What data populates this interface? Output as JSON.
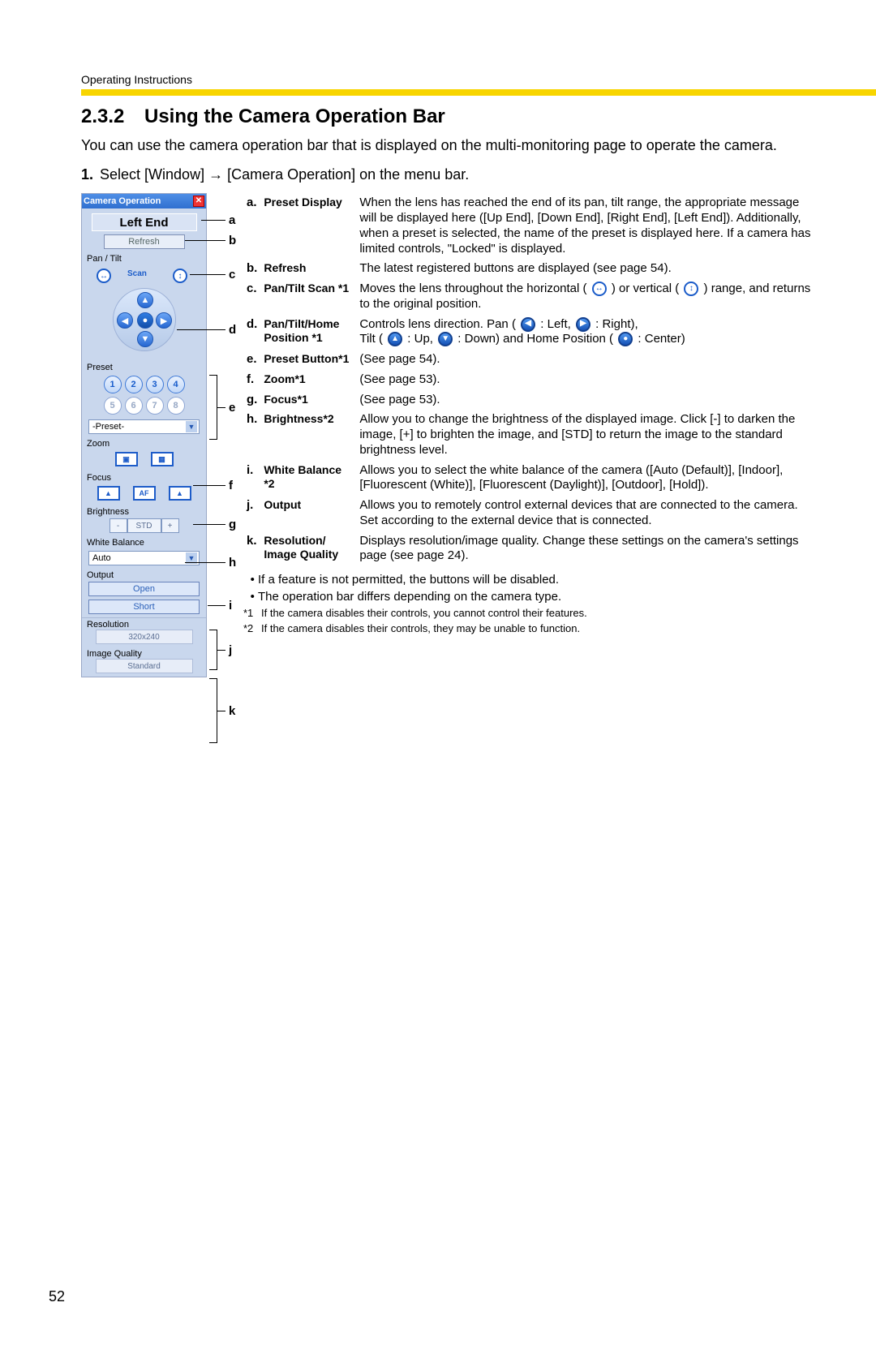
{
  "running_head": "Operating Instructions",
  "section": {
    "number": "2.3.2",
    "title": "Using the Camera Operation Bar"
  },
  "intro": "You can use the camera operation bar that is displayed on the multi-monitoring page to operate the camera.",
  "step1": {
    "num": "1.",
    "text_a": "Select [Window] ",
    "arrow": "→",
    "text_b": " [Camera Operation] on the menu bar."
  },
  "panel": {
    "title": "Camera Operation",
    "preset_display": "Left End",
    "refresh": "Refresh",
    "labels": {
      "pan_tilt": "Pan / Tilt",
      "scan": "Scan",
      "preset": "Preset",
      "zoom": "Zoom",
      "focus": "Focus",
      "brightness": "Brightness",
      "white_balance": "White Balance",
      "output": "Output",
      "resolution": "Resolution",
      "image_quality": "Image Quality"
    },
    "preset_dropdown": "-Preset-",
    "presets_active": [
      "1",
      "2",
      "3",
      "4"
    ],
    "presets_dim": [
      "5",
      "6",
      "7",
      "8"
    ],
    "brightness_buttons": {
      "minus": "-",
      "std": "STD",
      "plus": "+"
    },
    "white_balance_value": "Auto",
    "output_buttons": {
      "open": "Open",
      "short": "Short"
    },
    "resolution_value": "320x240",
    "image_quality_value": "Standard"
  },
  "callouts": {
    "a": "a",
    "b": "b",
    "c": "c",
    "d": "d",
    "e": "e",
    "f": "f",
    "g": "g",
    "h": "h",
    "i": "i",
    "j": "j",
    "k": "k"
  },
  "defs": {
    "a": {
      "l": "a.",
      "t": "Preset Display",
      "d": "When the lens has reached the end of its pan, tilt range, the appropriate message will be displayed here ([Up End], [Down End], [Right End], [Left End]). Additionally, when a preset is selected, the name of the preset is displayed here. If a camera has limited controls, \"Locked\" is displayed."
    },
    "b": {
      "l": "b.",
      "t": "Refresh",
      "d": "The latest registered buttons are displayed (see page 54)."
    },
    "c": {
      "l": "c.",
      "t": "Pan/Tilt Scan *1",
      "d_pre": "Moves the lens throughout the horizontal ( ",
      "d_mid": " ) or vertical ( ",
      "d_post": " ) range, and returns to the original position."
    },
    "d": {
      "l": "d.",
      "t": "Pan/Tilt/Home Position *1",
      "d1a": "Controls lens direction. Pan ( ",
      "d1b": " : Left, ",
      "d1c": " : Right),",
      "d2a": "Tilt ( ",
      "d2b": " : Up, ",
      "d2c": " : Down) and Home Position ( ",
      "d2d": " : Center)"
    },
    "e": {
      "l": "e.",
      "t": "Preset Button*1",
      "d": "(See page 54)."
    },
    "f": {
      "l": "f.",
      "t": "Zoom*1",
      "d": "(See page 53)."
    },
    "g": {
      "l": "g.",
      "t": "Focus*1",
      "d": "(See page 53)."
    },
    "h": {
      "l": "h.",
      "t": "Brightness*2",
      "d": "Allow you to change the brightness of the displayed image. Click [-] to darken the image, [+] to brighten the image, and [STD] to return the image to the standard brightness level."
    },
    "i": {
      "l": "i.",
      "t": "White Balance *2",
      "d": "Allows you to select the white balance of the camera ([Auto (Default)], [Indoor], [Fluorescent (White)], [Fluorescent (Daylight)], [Outdoor], [Hold])."
    },
    "j": {
      "l": "j.",
      "t": "Output",
      "d": "Allows you to remotely control external devices that are connected to the camera. Set according to the external device that is connected."
    },
    "k": {
      "l": "k.",
      "t": "Resolution/ Image Quality",
      "d": "Displays resolution/image quality. Change these settings on the camera's settings page (see page 24)."
    }
  },
  "notes": {
    "b1": "If a feature is not permitted, the buttons will be disabled.",
    "b2": "The operation bar differs depending on the camera type.",
    "n1": "If the camera disables their controls, you cannot control their features.",
    "n2": "If the camera disables their controls, they may be unable to function.",
    "n1_label": "*1",
    "n2_label": "*2"
  },
  "page_number": "52"
}
